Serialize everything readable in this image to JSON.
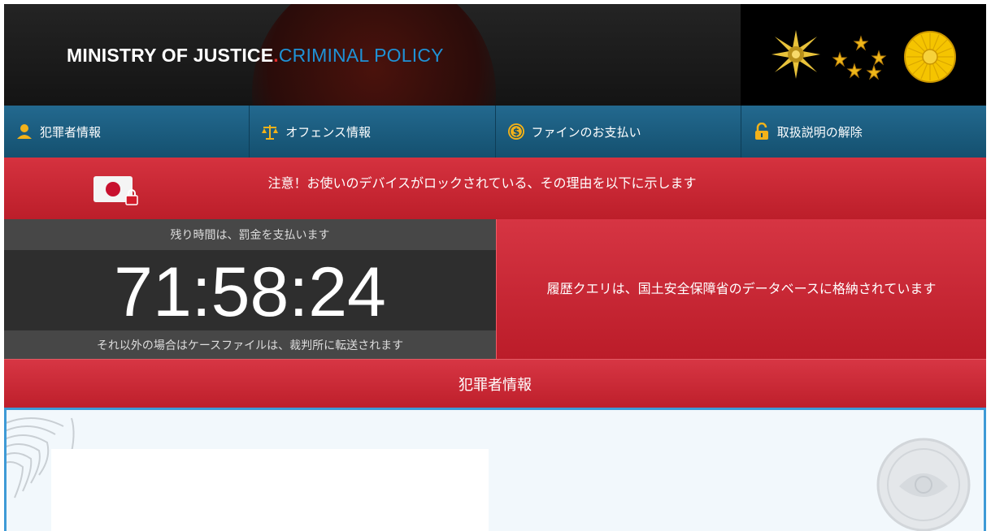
{
  "header": {
    "logo_part1": "MINISTRY OF JUSTICE",
    "logo_dot": ".",
    "logo_part2": "CRIMINAL POLICY"
  },
  "nav": {
    "items": [
      {
        "label": "犯罪者情報",
        "icon": "user-icon"
      },
      {
        "label": "オフェンス情報",
        "icon": "scales-icon"
      },
      {
        "label": "ファインのお支払い",
        "icon": "dollar-icon"
      },
      {
        "label": "取扱説明の解除",
        "icon": "unlock-icon"
      }
    ]
  },
  "alert": {
    "text": "注意！お使いのデバイスがロックされている、その理由を以下に示します",
    "icon": "japan-flag-lock-icon"
  },
  "timer": {
    "top_label": "残り時間は、罰金を支払います",
    "value": "71:58:24",
    "bottom_label": "それ以外の場合はケースファイルは、裁判所に転送されます"
  },
  "history": {
    "text": "履歴クエリは、国土安全保障省のデータベースに格納されています"
  },
  "section": {
    "title": "犯罪者情報"
  },
  "colors": {
    "red": "#c8222e",
    "nav_blue": "#1b5d80",
    "logo_blue": "#1f92d6",
    "gold": "#f5c400"
  }
}
